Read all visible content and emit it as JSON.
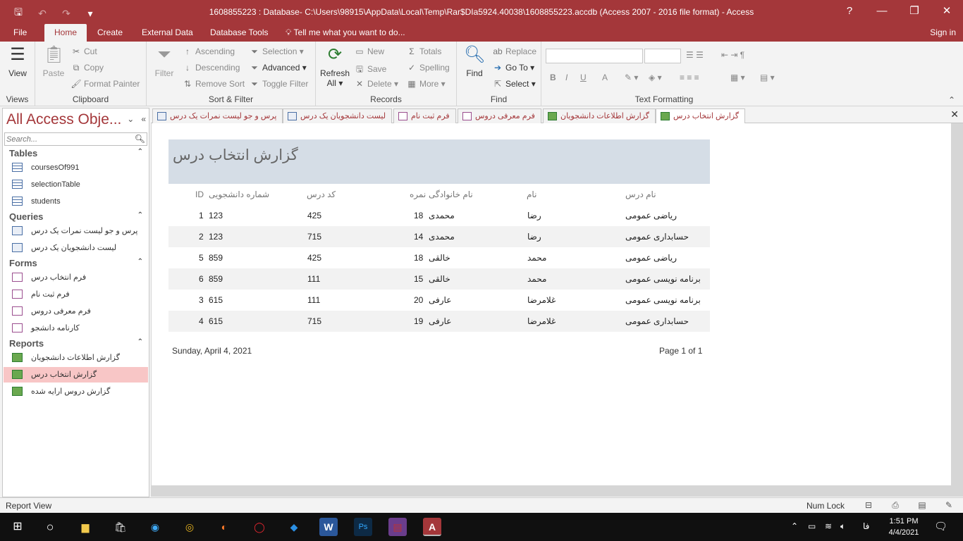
{
  "window": {
    "title": "1608855223 : Database- C:\\Users\\98915\\AppData\\Local\\Temp\\Rar$DIa5924.40038\\1608855223.accdb (Access 2007 - 2016 file format) - Access",
    "help": "?",
    "minimize": "—",
    "maximize": "❐",
    "close": "✕"
  },
  "qat": {
    "save": "🖫",
    "undo": "↶",
    "redo": "↷",
    "customize": "▾"
  },
  "ribbon_tabs": {
    "file": "File",
    "home": "Home",
    "create": "Create",
    "external": "External Data",
    "dbtools": "Database Tools",
    "tell": "Tell me what you want to do...",
    "signin": "Sign in"
  },
  "ribbon": {
    "views": {
      "view": "View",
      "label": "Views"
    },
    "clipboard": {
      "paste": "Paste",
      "cut": "Cut",
      "copy": "Copy",
      "format_painter": "Format Painter",
      "label": "Clipboard"
    },
    "sort": {
      "filter": "Filter",
      "ascending": "Ascending",
      "descending": "Descending",
      "remove_sort": "Remove Sort",
      "selection": "Selection",
      "advanced": "Advanced",
      "toggle_filter": "Toggle Filter",
      "label": "Sort & Filter"
    },
    "records": {
      "refresh": "Refresh",
      "refresh_all": "All",
      "new": "New",
      "save": "Save",
      "delete": "Delete",
      "totals": "Totals",
      "spelling": "Spelling",
      "more": "More",
      "label": "Records"
    },
    "find": {
      "find": "Find",
      "replace": "Replace",
      "goto": "Go To",
      "select": "Select",
      "label": "Find"
    },
    "text": {
      "label": "Text Formatting",
      "bold": "B",
      "italic": "I",
      "underline": "U",
      "font_color": "A"
    }
  },
  "nav": {
    "title": "All Access Obje...",
    "search_placeholder": "Search...",
    "sections": {
      "tables": "Tables",
      "queries": "Queries",
      "forms": "Forms",
      "reports": "Reports"
    },
    "tables": [
      "coursesOf991",
      "selectionTable",
      "students"
    ],
    "queries": [
      "پرس و جو لیست نمرات یک درس",
      "لیست دانشجویان یک درس"
    ],
    "forms": [
      "فرم انتخاب درس",
      "فرم ثبت نام",
      "فرم معرفی دروس",
      "کارنامه دانشجو"
    ],
    "reports": [
      "گزارش اطلاعات دانشجویان",
      "گزارش انتخاب درس",
      "گزارش دروس ارایه شده"
    ]
  },
  "doc_tabs": [
    "گزارش انتخاب درس",
    "گزارش اطلاعات دانشجویان",
    "فرم معرفی دروس",
    "فرم ثبت نام",
    "لیست دانشجویان یک درس",
    "پرس و جو لیست نمرات یک درس"
  ],
  "doc_close": "✕",
  "report": {
    "title": "گزارش انتخاب درس",
    "headers": {
      "id": "ID",
      "student_no": "شماره دانشجویی",
      "course_code": "کد درس",
      "grade": "نمره",
      "family": "نام خانوادگی",
      "name": "نام",
      "course_name": "نام درس"
    },
    "rows": [
      {
        "id": "1",
        "student_no": "123",
        "course_code": "425",
        "grade": "18",
        "family": "محمدی",
        "name": "رضا",
        "course_name": "ریاضی عمومی"
      },
      {
        "id": "2",
        "student_no": "123",
        "course_code": "715",
        "grade": "14",
        "family": "محمدی",
        "name": "رضا",
        "course_name": "حسابداری عمومی"
      },
      {
        "id": "5",
        "student_no": "859",
        "course_code": "425",
        "grade": "18",
        "family": "خالقی",
        "name": "محمد",
        "course_name": "ریاضی عمومی"
      },
      {
        "id": "6",
        "student_no": "859",
        "course_code": "111",
        "grade": "15",
        "family": "خالقی",
        "name": "محمد",
        "course_name": "برنامه نویسی عمومی"
      },
      {
        "id": "3",
        "student_no": "615",
        "course_code": "111",
        "grade": "20",
        "family": "عارفی",
        "name": "غلامرضا",
        "course_name": "برنامه نویسی عمومی"
      },
      {
        "id": "4",
        "student_no": "615",
        "course_code": "715",
        "grade": "19",
        "family": "عارفی",
        "name": "غلامرضا",
        "course_name": "حسابداری عمومی"
      }
    ],
    "date": "Sunday, April 4, 2021",
    "page": "Page 1 of 1"
  },
  "status": {
    "left": "Report View",
    "numlock": "Num Lock"
  },
  "taskbar": {
    "lang": "فا",
    "time": "1:51 PM",
    "date": "4/4/2021",
    "apps": [
      "Start",
      "Search",
      "File Explorer",
      "Store",
      "Edge",
      "Chrome",
      "Firefox",
      "Opera",
      "VS Code",
      "Word",
      "Photoshop",
      "WinRAR",
      "Access"
    ]
  }
}
